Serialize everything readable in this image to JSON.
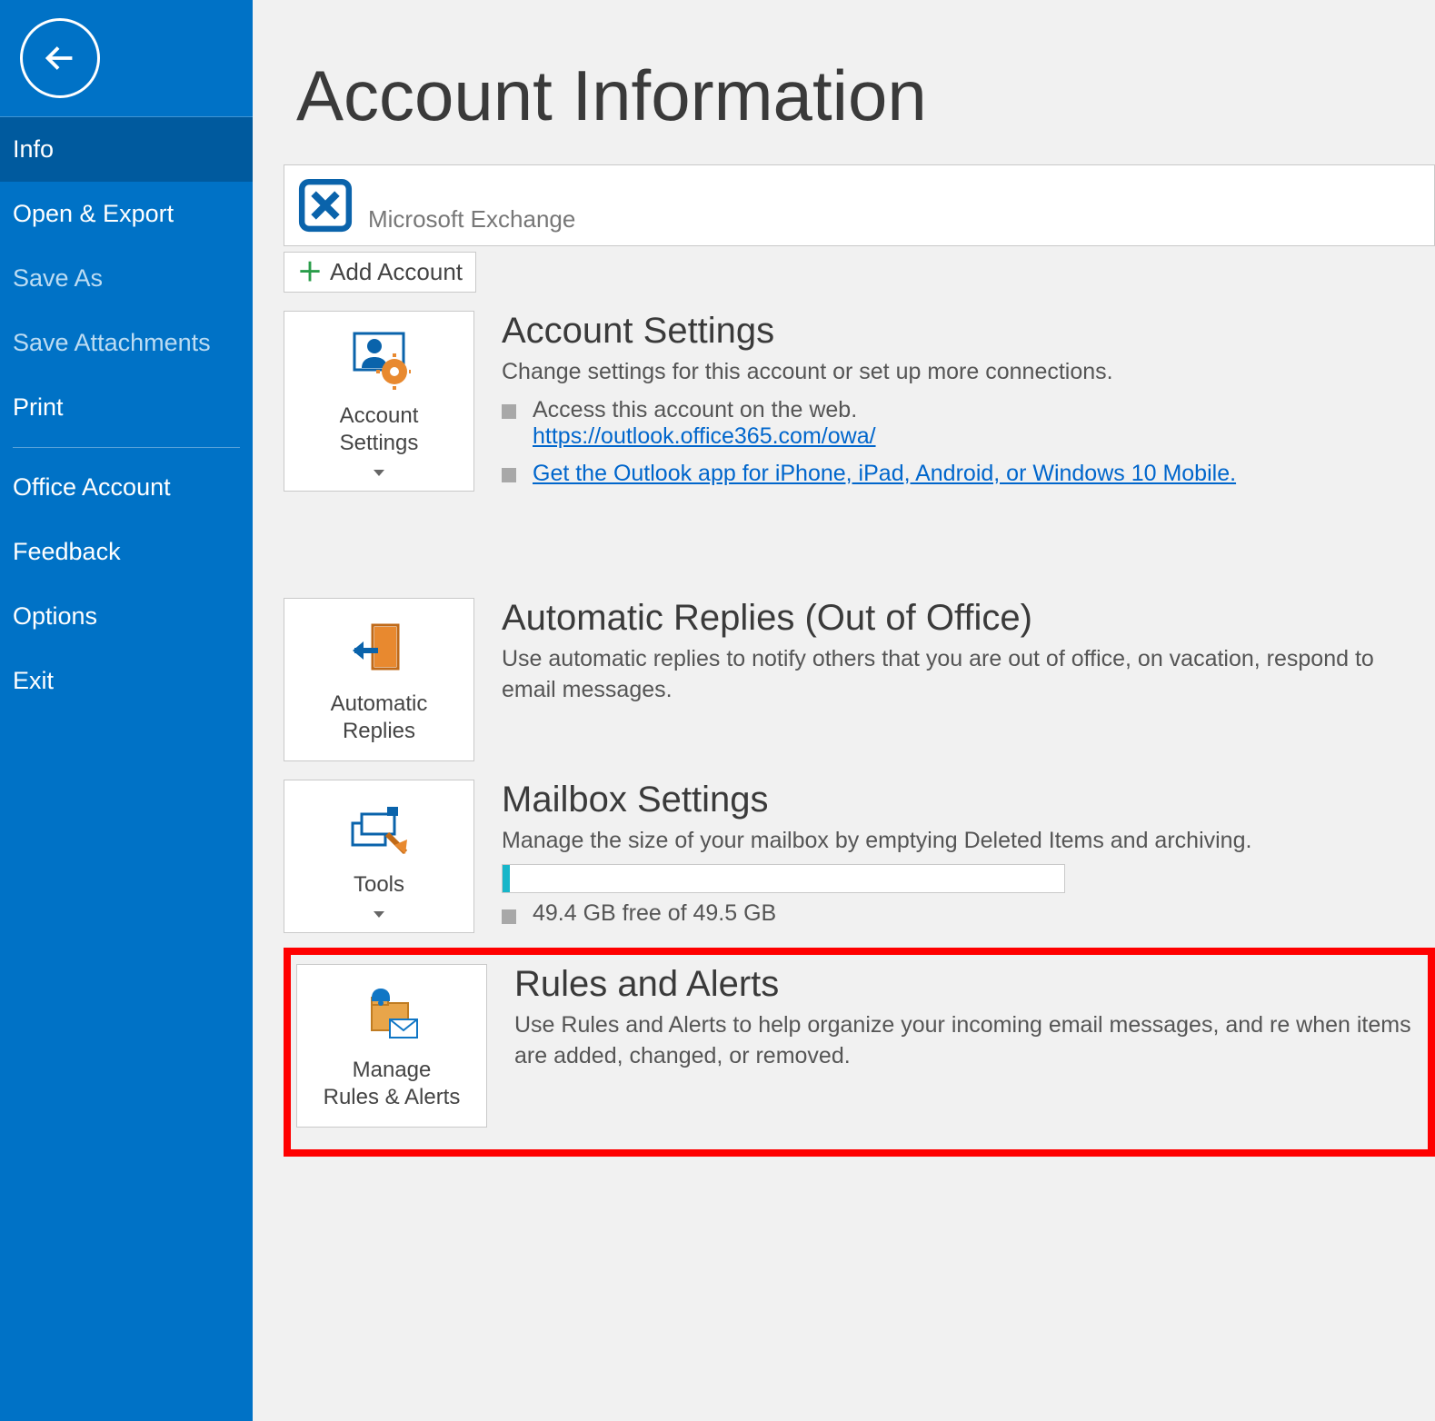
{
  "sidebar": {
    "items": [
      {
        "label": "Info",
        "active": true,
        "dim": false
      },
      {
        "label": "Open & Export",
        "active": false,
        "dim": false
      },
      {
        "label": "Save As",
        "active": false,
        "dim": true
      },
      {
        "label": "Save Attachments",
        "active": false,
        "dim": true
      },
      {
        "label": "Print",
        "active": false,
        "dim": false
      },
      {
        "label": "Office Account",
        "active": false,
        "dim": false
      },
      {
        "label": "Feedback",
        "active": false,
        "dim": false
      },
      {
        "label": "Options",
        "active": false,
        "dim": false
      },
      {
        "label": "Exit",
        "active": false,
        "dim": false
      }
    ]
  },
  "page": {
    "title": "Account Information"
  },
  "account": {
    "type": "Microsoft Exchange",
    "add_label": "Add Account"
  },
  "sections": {
    "settings": {
      "button": "Account\nSettings",
      "title": "Account Settings",
      "desc": "Change settings for this account or set up more connections.",
      "bullets": [
        {
          "text": "Access this account on the web.",
          "link": "https://outlook.office365.com/owa/"
        },
        {
          "link_only": "Get the Outlook app for iPhone, iPad, Android, or Windows 10 Mobile."
        }
      ]
    },
    "auto": {
      "button": "Automatic\nReplies",
      "title": "Automatic Replies (Out of Office)",
      "desc": "Use automatic replies to notify others that you are out of office, on vacation, respond to email messages."
    },
    "mailbox": {
      "button": "Tools",
      "title": "Mailbox Settings",
      "desc": "Manage the size of your mailbox by emptying Deleted Items and archiving.",
      "free": "49.4 GB free of 49.5 GB"
    },
    "rules": {
      "button": "Manage\nRules & Alerts",
      "title": "Rules and Alerts",
      "desc": "Use Rules and Alerts to help organize your incoming email messages, and re when items are added, changed, or removed."
    }
  }
}
